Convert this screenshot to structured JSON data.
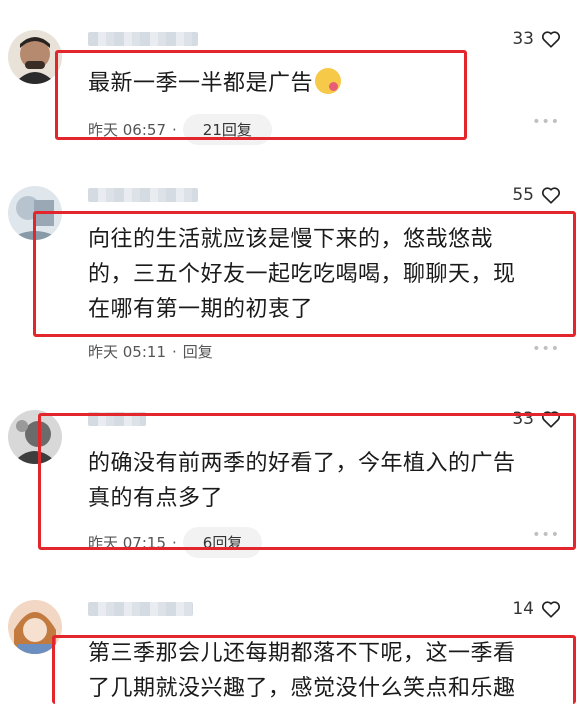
{
  "comments": [
    {
      "likes": "33",
      "text": "最新一季一半都是广告",
      "time": "昨天 06:57",
      "reply": "21回复"
    },
    {
      "likes": "55",
      "text_lines": [
        "向往的生活就应该是慢下来的，悠哉悠哉",
        "的，三五个好友一起吃吃喝喝，聊聊天，现",
        "在哪有第一期的初衷了"
      ],
      "time": "昨天 05:11",
      "reply": "回复"
    },
    {
      "likes": "33",
      "text_lines": [
        "的确没有前两季的好看了，今年植入的广告",
        "真的有点多了"
      ],
      "time": "昨天 07:15",
      "reply": "6回复"
    },
    {
      "likes": "14",
      "text_lines": [
        "第三季那会儿还每期都落不下呢，这一季看",
        "了几期就没兴趣了，感觉没什么笑点和乐趣"
      ]
    }
  ],
  "icons": {
    "like": "heart-outline-icon",
    "more": "more-dots-icon",
    "emoji": "tongue-out-face-emoji"
  },
  "colors": {
    "highlight": "#e3262b",
    "pill_bg": "#f2f2f2"
  }
}
